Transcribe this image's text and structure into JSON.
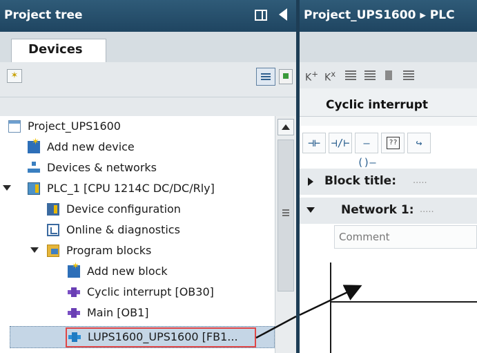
{
  "project_tree": {
    "title": "Project tree",
    "tab": "Devices",
    "items": [
      {
        "label": "Project_UPS1600",
        "icon": "project-icon"
      },
      {
        "label": "Add new device",
        "icon": "add-device-icon"
      },
      {
        "label": "Devices & networks",
        "icon": "network-icon"
      },
      {
        "label": "PLC_1 [CPU 1214C DC/DC/Rly]",
        "icon": "plc-icon"
      },
      {
        "label": "Device configuration",
        "icon": "device-config-icon"
      },
      {
        "label": "Online & diagnostics",
        "icon": "online-diagnostics-icon"
      },
      {
        "label": "Program blocks",
        "icon": "folder-icon"
      },
      {
        "label": "Add new block",
        "icon": "add-block-icon"
      },
      {
        "label": "Cyclic interrupt [OB30]",
        "icon": "ob-block-icon"
      },
      {
        "label": "Main [OB1]",
        "icon": "ob-block-icon"
      },
      {
        "label": "LUPS1600_UPS1600 [FB1...",
        "icon": "fb-block-icon"
      }
    ]
  },
  "editor": {
    "breadcrumb": "Project_UPS1600 ▸ PLC",
    "block_name": "Cyclic interrupt",
    "block_title_label": "Block title:",
    "block_title_placeholder": ".....",
    "network_label": "Network 1:",
    "network_placeholder": ".....",
    "comment_placeholder": "Comment",
    "lad_tools": [
      "⊣⊢",
      "⊣/⊢",
      "–()–",
      "??"
    ]
  },
  "colors": {
    "header_bg": "#2a506c",
    "selection_bg": "#c5d6e6",
    "highlight_border": "#e04646"
  }
}
